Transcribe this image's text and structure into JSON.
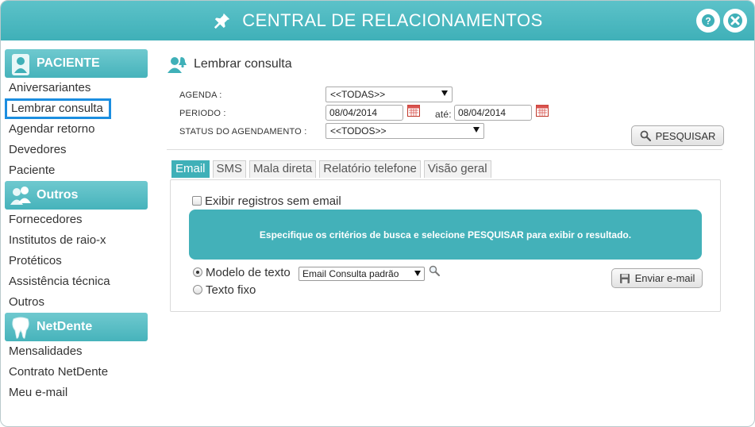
{
  "window": {
    "title": "CENTRAL DE RELACIONAMENTOS",
    "accent_color": "#3fb0b8",
    "icons": {
      "pin": "pin-icon",
      "help": "help-icon",
      "close": "close-icon"
    }
  },
  "sidebar": {
    "sections": [
      {
        "title": "PACIENTE",
        "icon": "patient-icon",
        "items": [
          "Aniversariantes",
          "Lembrar consulta",
          "Agendar retorno",
          "Devedores",
          "Paciente"
        ]
      },
      {
        "title": "Outros",
        "icon": "group-icon",
        "items": [
          "Fornecedores",
          "Institutos de raio-x",
          "Protéticos",
          "Assistência técnica",
          "Outros"
        ]
      },
      {
        "title": "NetDente",
        "icon": "tooth-icon",
        "items": [
          "Mensalidades",
          "Contrato NetDente",
          "Meu e-mail"
        ]
      }
    ],
    "selected_item": "Lembrar consulta"
  },
  "main": {
    "title": "Lembrar consulta",
    "form": {
      "agenda_label": "AGENDA :",
      "agenda_value": "<<TODAS>>",
      "periodo_label": "PERIODO :",
      "periodo_from": "08/04/2014",
      "ate_label": "até:",
      "periodo_to": "08/04/2014",
      "status_label": "STATUS DO AGENDAMENTO :",
      "status_value": "<<TODOS>>",
      "search_button": "PESQUISAR"
    },
    "tabs": [
      {
        "label": "Email",
        "active": true
      },
      {
        "label": "SMS",
        "active": false
      },
      {
        "label": "Mala direta",
        "active": false
      },
      {
        "label": "Relatório telefone",
        "active": false
      },
      {
        "label": "Visão geral",
        "active": false
      }
    ],
    "email_panel": {
      "checkbox_label": "Exibir registros sem email",
      "checkbox_checked": false,
      "info_message": "Especifique os critérios de busca e selecione PESQUISAR para exibir o resultado.",
      "radio_template_label": "Modelo de texto",
      "radio_fixed_label": "Texto fixo",
      "selected_radio": "Modelo de texto",
      "template_value": "Email Consulta padrão",
      "send_button": "Enviar e-mail"
    }
  }
}
